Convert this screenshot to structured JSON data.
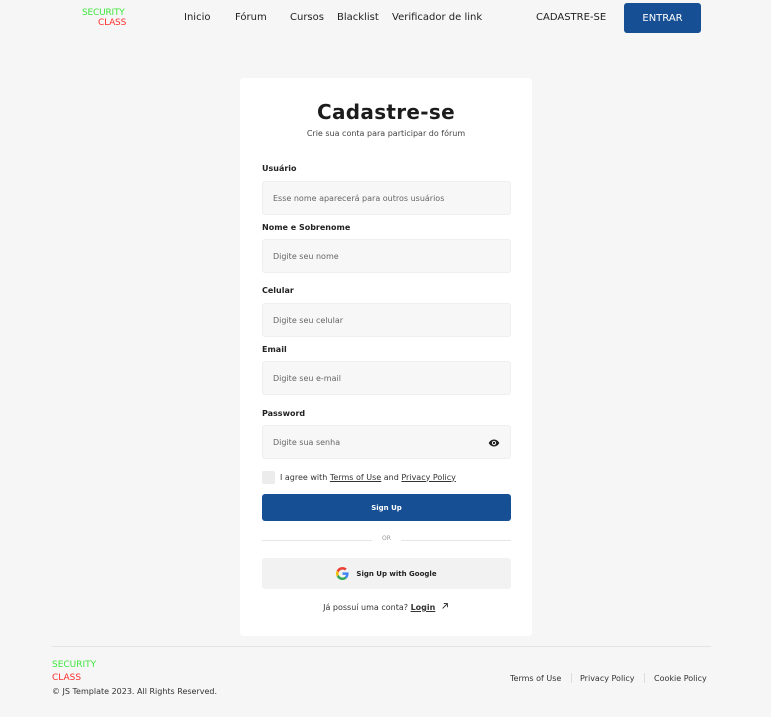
{
  "header": {
    "logo_line1": "SECURITY",
    "logo_line2": "CLASS",
    "nav": [
      "Inicio",
      "Fórum",
      "Cursos",
      "Blacklist",
      "Verificador de link"
    ],
    "signup_link": "CADASTRE-SE",
    "login_button": "ENTRAR"
  },
  "form": {
    "title": "Cadastre-se",
    "subtitle": "Crie sua conta para participar do fórum",
    "fields": [
      {
        "label": "Usuário",
        "placeholder": "Esse nome aparecerá para outros usuários"
      },
      {
        "label": "Nome e Sobrenome",
        "placeholder": "Digite seu nome"
      },
      {
        "label": "Celular",
        "placeholder": "Digite seu celular"
      },
      {
        "label": "Email",
        "placeholder": "Digite seu e-mail"
      },
      {
        "label": "Password",
        "placeholder": "Digite sua senha"
      }
    ],
    "agree_prefix": "I agree with",
    "terms_link": "Terms of Use",
    "agree_and": "and",
    "privacy_link": "Privacy Policy",
    "signup_button": "Sign Up",
    "or_text": "OR",
    "google_button": "Sign Up with Google",
    "have_account": "Já possuí uma conta?",
    "login_link": "Login"
  },
  "footer": {
    "logo_line1": "SECURITY",
    "logo_line2": "CLASS",
    "copyright": "© JS Template 2023. All Rights Reserved.",
    "links": [
      "Terms of Use",
      "Privacy Policy",
      "Cookie Policy"
    ]
  },
  "colors": {
    "primary": "#164f93",
    "logo_green": "#3ee63e",
    "logo_red": "#ff2d2d",
    "background": "#f6f6f6"
  },
  "icons": {
    "password_toggle": "eye-icon",
    "google": "google-icon",
    "login_arrow": "arrow-up-right-icon"
  }
}
